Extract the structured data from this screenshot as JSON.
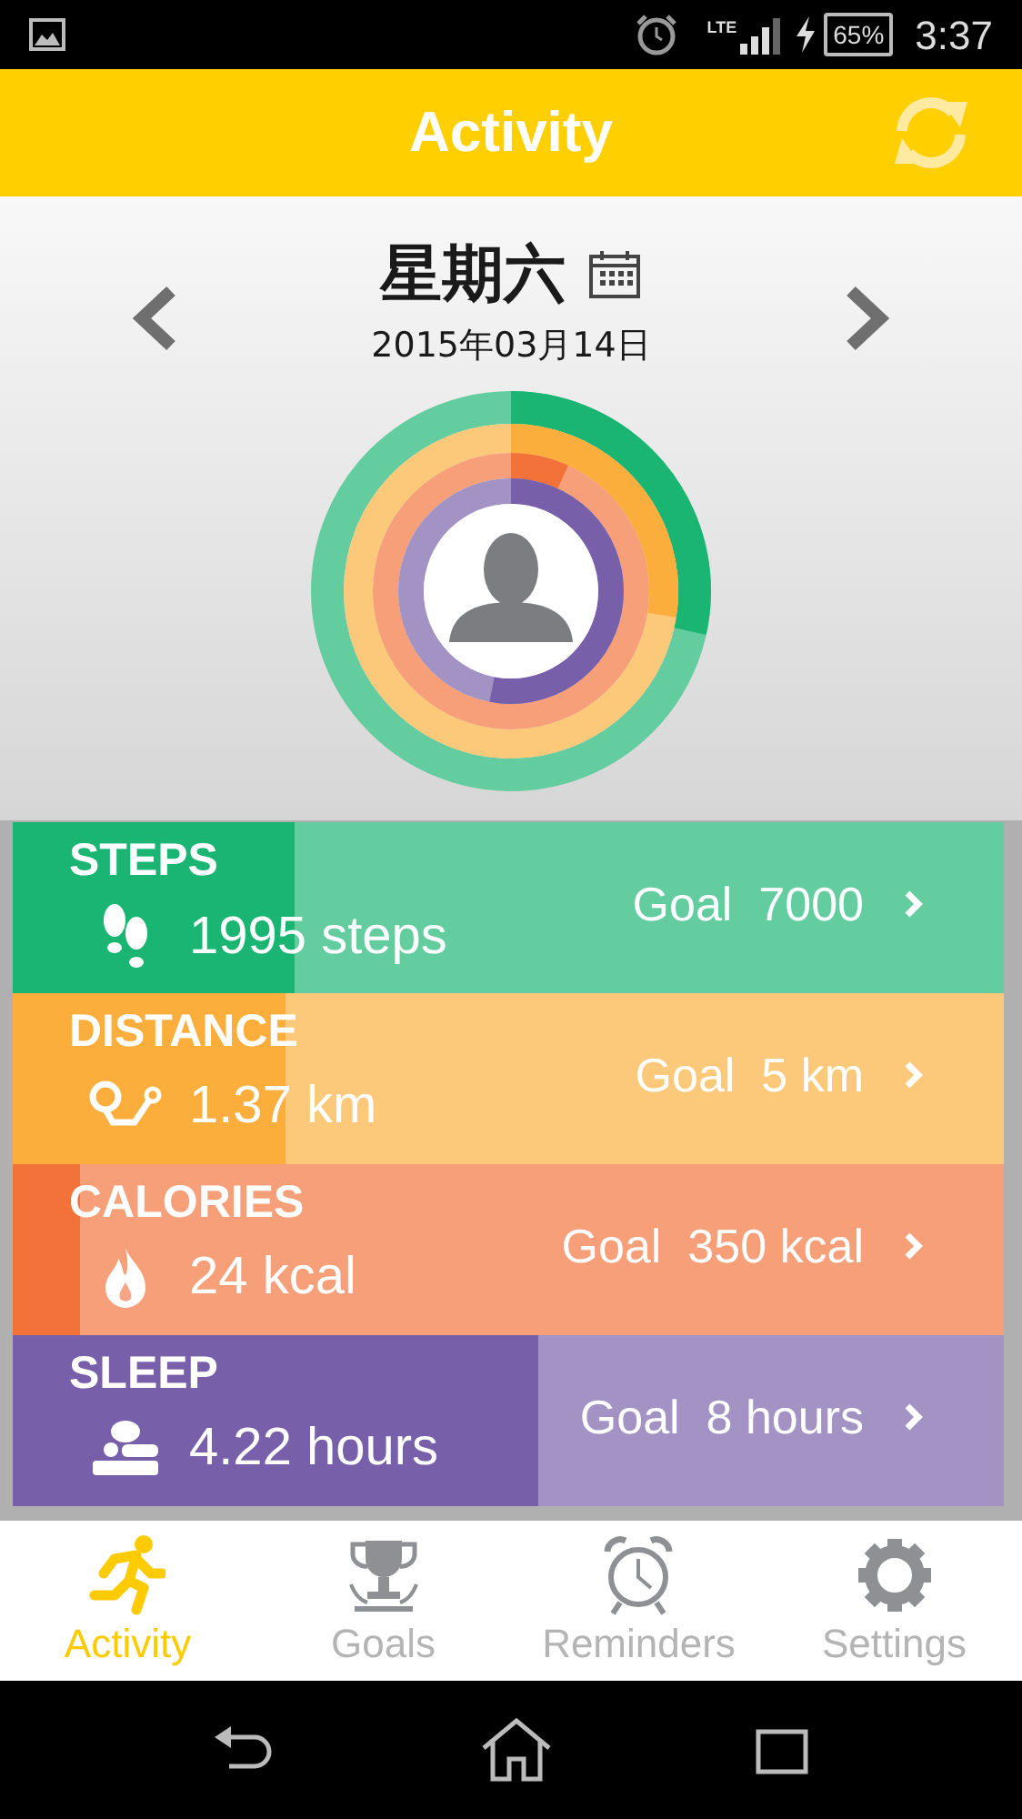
{
  "status_bar": {
    "network": "LTE",
    "battery": "65%",
    "time": "3:37"
  },
  "header": {
    "title": "Activity"
  },
  "date": {
    "weekday": "星期六",
    "date": "2015年03月14日"
  },
  "metrics": [
    {
      "kind": "steps",
      "title": "STEPS",
      "value": "1995 steps",
      "goal": "Goal  7000",
      "level": 0.285,
      "color": "#1bb573"
    },
    {
      "kind": "distance",
      "title": "DISTANCE",
      "value": "1.37 km",
      "goal": "Goal  5 km",
      "level": 0.275,
      "color": "#fbae3c"
    },
    {
      "kind": "calories",
      "title": "CALORIES",
      "value": "24 kcal",
      "goal": "Goal  350 kcal",
      "level": 0.068,
      "color": "#f2723a"
    },
    {
      "kind": "sleep",
      "title": "SLEEP",
      "value": "4.22 hours",
      "goal": "Goal  8 hours",
      "level": 0.53,
      "color": "#7760a9"
    }
  ],
  "tabs": [
    {
      "kind": "activity",
      "label": "Activity",
      "selected": true
    },
    {
      "kind": "goals",
      "label": "Goals",
      "selected": false
    },
    {
      "kind": "reminders",
      "label": "Reminders",
      "selected": false
    },
    {
      "kind": "settings",
      "label": "Settings",
      "selected": false
    }
  ]
}
